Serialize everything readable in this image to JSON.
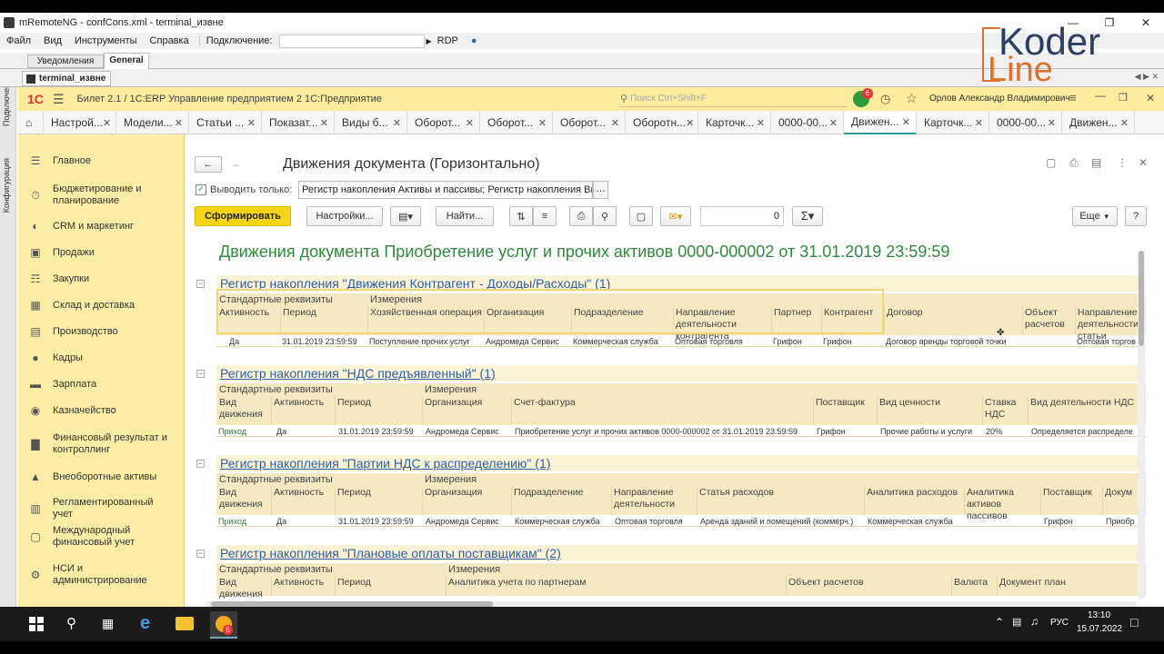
{
  "app": {
    "title": "mRemoteNG - confCons.xml - terminal_извне",
    "menu": [
      "Файл",
      "Вид",
      "Инструменты",
      "Справка"
    ],
    "connection_label": "Подключение:",
    "rdp_label": "RDP",
    "tabs_top": [
      "Уведомления",
      "General"
    ],
    "session_tab": "terminal_извне",
    "side_labels": [
      "Подключения",
      "Конфигурация"
    ]
  },
  "watermark": {
    "line1": "Koder",
    "line2": "Line"
  },
  "onec": {
    "logo": "1С",
    "app_title": "Билет 2.1 / 1С:ERP Управление предприятием 2 1С:Предприятие",
    "search_placeholder": "Поиск Ctrl+Shift+F",
    "notif_count": "6",
    "user": "Орлов Александр Владимирович",
    "nav_tabs": [
      "Настрой...",
      "Модели...",
      "Статьи ...",
      "Показат...",
      "Виды  б...",
      "Оборот...",
      "Оборот...",
      "Оборот...",
      "Оборотн...",
      "Карточк...",
      "0000-00...",
      "Движен...",
      "Карточк...",
      "0000-00...",
      "Движен..."
    ],
    "sidebar": [
      "Главное",
      "Бюджетирование и планирование",
      "CRM и маркетинг",
      "Продажи",
      "Закупки",
      "Склад и доставка",
      "Производство",
      "Кадры",
      "Зарплата",
      "Казначейство",
      "Финансовый результат и контроллинг",
      "Внеоборотные активы",
      "Регламентированный учет",
      "Международный финансовый учет",
      "НСИ и администрирование"
    ]
  },
  "form": {
    "title": "Движения документа (Горизонтально)",
    "checkbox_label": "Выводить только:",
    "filter_value": "Регистр накопления Активы и пассивы; Регистр накопления Вы",
    "btn_generate": "Сформировать",
    "btn_settings": "Настройки...",
    "btn_find": "Найти...",
    "number_value": "0",
    "btn_more": "Еще",
    "btn_help": "?"
  },
  "report": {
    "main_title": "Движения документа Приобретение услуг и прочих активов 0000-000002 от 31.01.2019 23:59:59",
    "sections": [
      {
        "title": "Регистр накопления \"Движения Контрагент - Доходы/Расходы\" (1)",
        "group_labels": [
          "Стандартные реквизиты",
          "Измерения"
        ],
        "columns": [
          "Активность",
          "Период",
          "Хозяйственная операция",
          "Организация",
          "Подразделение",
          "Направление деятельности контрагента",
          "Партнер",
          "Контрагент",
          "Договор",
          "Объект расчетов",
          "Направление деятельности статьи"
        ],
        "row": [
          "Да",
          "31.01.2019 23:59:59",
          "Поступление прочих услуг",
          "Андромеда Сервис",
          "Коммерческая служба",
          "Оптовая торговля",
          "Грифон",
          "Грифон",
          "Договор аренды торговой точки",
          "",
          "Оптовая торгов"
        ]
      },
      {
        "title": "Регистр накопления \"НДС предъявленный\" (1)",
        "group_labels": [
          "Стандартные реквизиты",
          "Измерения"
        ],
        "columns": [
          "Вид движения",
          "Активность",
          "Период",
          "Организация",
          "Счет-фактура",
          "Поставщик",
          "Вид ценности",
          "Ставка НДС",
          "Вид деятельности НДС"
        ],
        "row": [
          "Приход",
          "Да",
          "31.01.2019 23:59:59",
          "Андромеда Сервис",
          "Приобретение услуг и прочих активов 0000-000002 от 31.01.2019 23:59:59",
          "Грифон",
          "Прочие работы и услуги",
          "20%",
          "Определяется распределе"
        ]
      },
      {
        "title": "Регистр накопления \"Партии НДС к распределению\" (1)",
        "group_labels": [
          "Стандартные реквизиты",
          "Измерения"
        ],
        "columns": [
          "Вид движения",
          "Активность",
          "Период",
          "Организация",
          "Подразделение",
          "Направление деятельности",
          "Статья расходов",
          "Аналитика расходов",
          "Аналитика активов пассивов",
          "Поставщик",
          "Докум"
        ],
        "row": [
          "Приход",
          "Да",
          "31.01.2019 23:59:59",
          "Андромеда Сервис",
          "Коммерческая служба",
          "Оптовая торговля",
          "Аренда зданий и помещений (коммерч.)",
          "Коммерческая служба",
          "",
          "Грифон",
          "Приобр"
        ]
      },
      {
        "title": "Регистр накопления \"Плановые оплаты поставщикам\" (2)",
        "group_labels": [
          "Стандартные реквизиты",
          "Измерения"
        ],
        "columns": [
          "Вид движения",
          "Активность",
          "Период",
          "Аналитика учета по партнерам",
          "Объект расчетов",
          "Валюта",
          "Документ план"
        ]
      }
    ]
  },
  "taskbar": {
    "lang": "РУС",
    "time": "13:10",
    "date": "15.07.2022",
    "badge": "6"
  }
}
